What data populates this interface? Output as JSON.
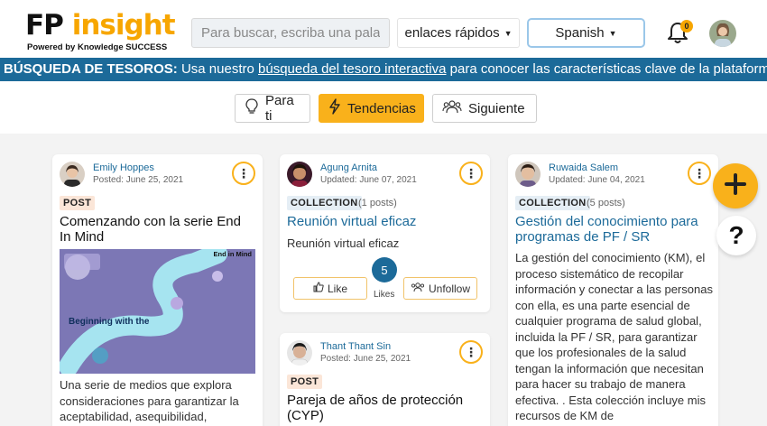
{
  "header": {
    "logo_fp": "FP",
    "logo_insight": "insight",
    "logo_sub": "Powered by Knowledge SUCCESS",
    "search_placeholder": "Para buscar, escriba una palabra",
    "quick_links": "enlaces rápidos",
    "language": "Spanish",
    "notification_count": "0"
  },
  "banner": {
    "strong": "BÚSQUEDA DE TESOROS:",
    "pre": " Usa nuestro ",
    "link": "búsqueda del tesoro interactiva",
    "post": " para conocer las características clave de la plataforma"
  },
  "filters": {
    "for_you": "Para ti",
    "trending": "Tendencias",
    "following": "Siguiente"
  },
  "cards": [
    {
      "author": "Emily Hoppes",
      "date": "Posted: June 25, 2021",
      "tag": "POST",
      "title": "Comenzando con la serie End In Mind",
      "thumb_top": "End in Mind",
      "thumb_mid": "Beginning with the",
      "description": "Una serie de medios que explora consideraciones para garantizar la aceptabilidad, asequibilidad,"
    },
    {
      "author": "Agung Arnita",
      "date": "Updated: June 07, 2021",
      "tag": "COLLECTION",
      "count": "(1 posts)",
      "title": "Reunión virtual eficaz",
      "description": "Reunión virtual eficaz",
      "like_label": "Like",
      "like_count": "5",
      "likes_label": "Likes",
      "unfollow_label": "Unfollow"
    },
    {
      "author": "Thant Thant Sin",
      "date": "Posted: June 25, 2021",
      "tag": "POST",
      "title": "Pareja de años de protección (CYP)"
    },
    {
      "author": "Ruwaida Salem",
      "date": "Updated: June 04, 2021",
      "tag": "COLLECTION",
      "count": "(5 posts)",
      "title": "Gestión del conocimiento para programas de PF / SR",
      "description": "La gestión del conocimiento (KM), el proceso sistemático de recopilar información y conectar a las personas con ella, es una parte esencial de cualquier programa de salud global, incluida la PF / SR, para garantizar que los profesionales de la salud tengan la información que necesitan para hacer su trabajo de manera efectiva. . Esta colección incluye mis recursos de KM de"
    }
  ],
  "colors": {
    "accent": "#f9b11b",
    "brand_blue": "#1c6a99",
    "logo_orange": "#f7a600"
  }
}
